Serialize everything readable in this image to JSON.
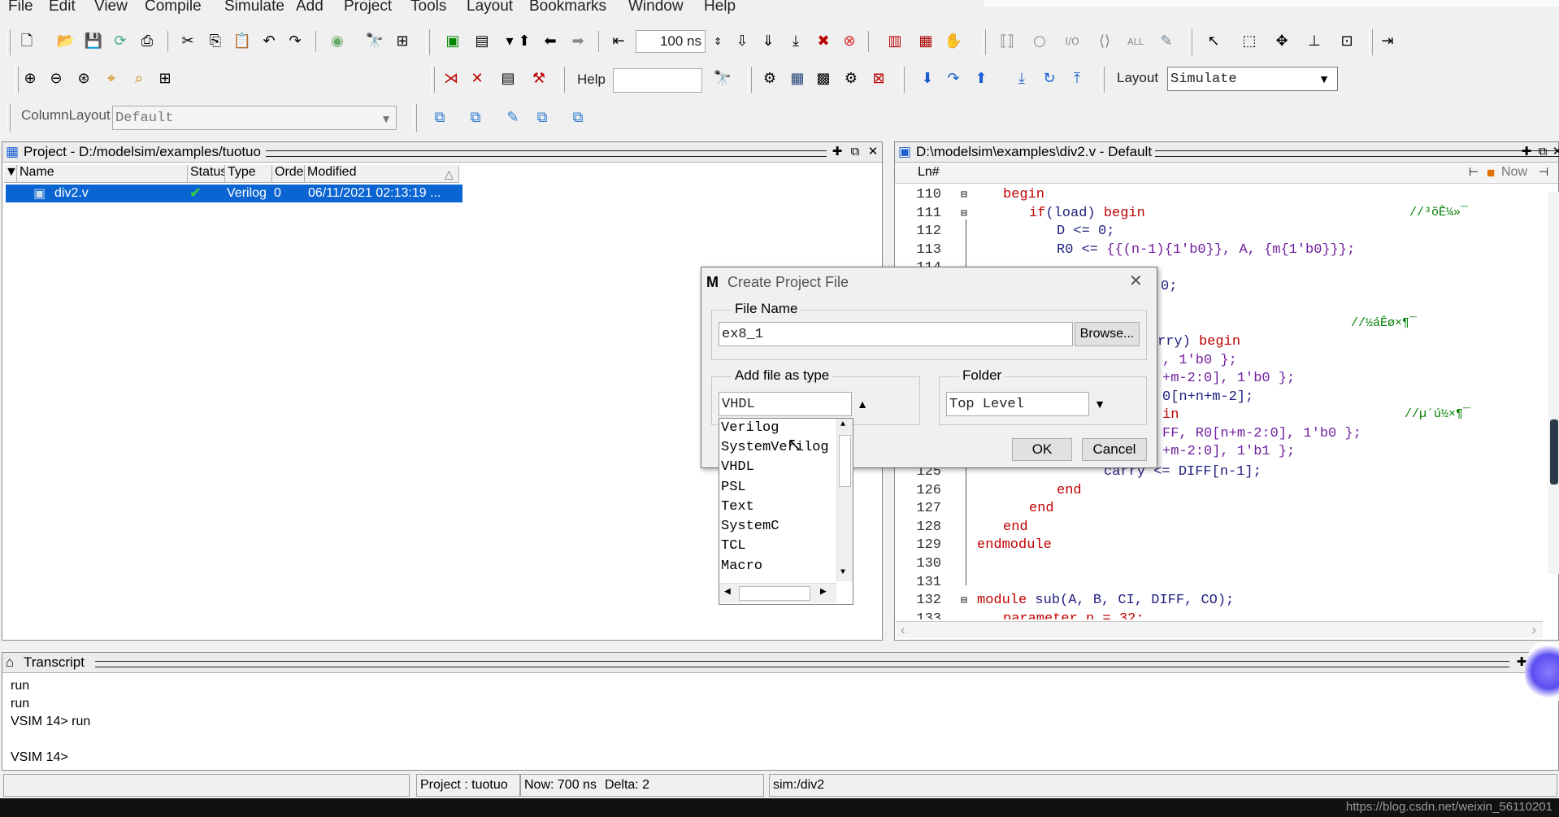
{
  "menu": [
    "File",
    "Edit",
    "View",
    "Compile",
    "Simulate",
    "Add",
    "Project",
    "Tools",
    "Layout",
    "Bookmarks",
    "Window",
    "Help"
  ],
  "toolbar": {
    "time_value": "100 ns",
    "help_label": "Help",
    "help_value": "",
    "layout_label": "Layout",
    "layout_value": "Simulate",
    "column_layout_label": "ColumnLayout",
    "column_layout_value": "Default"
  },
  "project_panel": {
    "title": "Project - D:/modelsim/examples/tuotuo",
    "columns": [
      "Name",
      "Status",
      "Type",
      "Order",
      "Modified"
    ],
    "rows": [
      {
        "name": "div2.v",
        "status": "✔",
        "type": "Verilog",
        "order": "0",
        "modified": "06/11/2021 02:13:19 ..."
      }
    ]
  },
  "source_panel": {
    "title": "D:\\modelsim\\examples\\div2.v - Default",
    "ln_header": "Ln#",
    "now_label": "Now"
  },
  "dialog": {
    "title": "Create Project File",
    "file_name_label": "File Name",
    "file_name_value": "ex8_1",
    "browse_label": "Browse...",
    "add_type_label": "Add file as type",
    "type_value": "VHDL",
    "folder_label": "Folder",
    "folder_value": "Top Level",
    "ok_label": "OK",
    "cancel_label": "Cancel",
    "type_options": [
      "Verilog",
      "SystemVerilog",
      "VHDL",
      "PSL",
      "Text",
      "SystemC",
      "TCL",
      "Macro"
    ]
  },
  "transcript": {
    "title": "Transcript",
    "lines": [
      "run",
      "run",
      "VSIM 14> run",
      "",
      "VSIM 14>"
    ]
  },
  "status": {
    "project": "Project : tuotuo",
    "now": "Now: 700 ns",
    "delta": "Delta: 2",
    "sim": "sim:/div2"
  },
  "watermark": "https://blog.csdn.net/weixin_56110201"
}
